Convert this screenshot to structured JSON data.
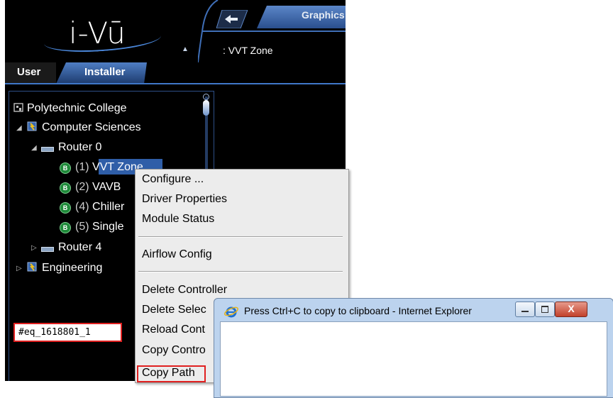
{
  "header": {
    "logo_text": "i-Vū",
    "graphics_tab": "Graphics",
    "zone_path": ": VVT Zone"
  },
  "tabs": [
    {
      "label": "User"
    },
    {
      "label": "Installer"
    }
  ],
  "tree": {
    "root": "Polytechnic College",
    "computer_sciences": "Computer Sciences",
    "router0": "Router 0",
    "items": [
      {
        "prefix": "(1)",
        "name": "VVT Zone"
      },
      {
        "prefix": "(2)",
        "name": "VAVB"
      },
      {
        "prefix": "(4)",
        "name": "Chiller"
      },
      {
        "prefix": "(5)",
        "name": "Single"
      }
    ],
    "router4": "Router 4",
    "engineering": "Engineering",
    "b_badge": "B"
  },
  "context_menu": {
    "items": [
      "Configure ...",
      "Driver Properties",
      "Module Status",
      "Airflow Config",
      "Delete Controller",
      "Delete Selec",
      "Reload Cont",
      "Copy Contro",
      "Copy Path"
    ]
  },
  "ie_dialog": {
    "title": "Press Ctrl+C to copy to clipboard - Internet Explorer",
    "value": "#eq_1618801_1",
    "close_glyph": "X"
  },
  "colors": {
    "panel_bg": "#000000",
    "accent": "#3f77c8",
    "highlight": "#e02020",
    "selection": "#2f5ea8"
  }
}
